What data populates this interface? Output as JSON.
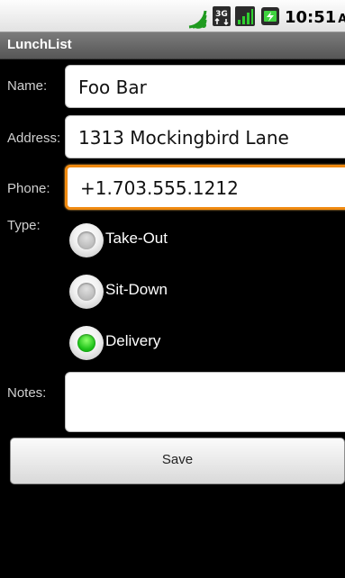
{
  "status_bar": {
    "time": "10:51",
    "am_pm": "AM",
    "icons": [
      "wifi-icon",
      "3g-data-icon",
      "signal-bars-icon",
      "battery-icon"
    ]
  },
  "app": {
    "title": "LunchList"
  },
  "form": {
    "name": {
      "label": "Name:",
      "value": "Foo Bar"
    },
    "address": {
      "label": "Address:",
      "value": "1313 Mockingbird Lane"
    },
    "phone": {
      "label": "Phone:",
      "value": "+1.703.555.1212"
    },
    "type": {
      "label": "Type:",
      "options": [
        {
          "label": "Take-Out",
          "selected": false
        },
        {
          "label": "Sit-Down",
          "selected": false
        },
        {
          "label": "Delivery",
          "selected": true
        }
      ]
    },
    "notes": {
      "label": "Notes:",
      "value": ""
    }
  },
  "save_label": "Save",
  "colors": {
    "focus": "#f08a10",
    "radio_selected": "#1fc41a",
    "background": "#000000"
  }
}
